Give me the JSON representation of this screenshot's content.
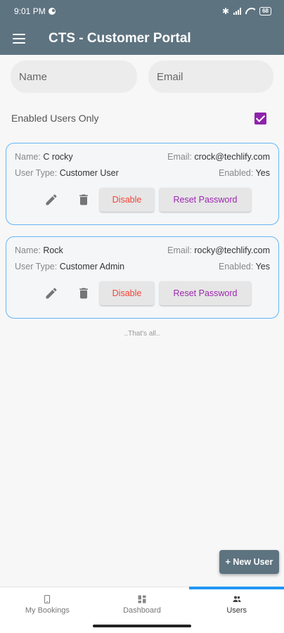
{
  "status_bar": {
    "time": "9:01 PM",
    "battery": "68"
  },
  "app_bar": {
    "title": "CTS - Customer Portal"
  },
  "search": {
    "name_placeholder": "Name",
    "email_placeholder": "Email"
  },
  "filter": {
    "enabled_only_label": "Enabled Users Only",
    "enabled_only_checked": true
  },
  "users": [
    {
      "name_label": "Name:",
      "name": "C rocky",
      "email_label": "Email:",
      "email": "crock@techlify.com",
      "type_label": "User Type:",
      "type": "Customer User",
      "enabled_label": "Enabled:",
      "enabled": "Yes",
      "disable_label": "Disable",
      "reset_label": "Reset Password"
    },
    {
      "name_label": "Name:",
      "name": "Rock",
      "email_label": "Email:",
      "email": "rocky@techlify.com",
      "type_label": "User Type:",
      "type": "Customer Admin",
      "enabled_label": "Enabled:",
      "enabled": "Yes",
      "disable_label": "Disable",
      "reset_label": "Reset Password"
    }
  ],
  "list_end_text": "..That's all..",
  "fab": {
    "label": "+ New User"
  },
  "bottom_nav": [
    {
      "label": "My Bookings",
      "icon": "phone-icon"
    },
    {
      "label": "Dashboard",
      "icon": "dashboard-icon"
    },
    {
      "label": "Users",
      "icon": "people-icon",
      "active": true
    }
  ],
  "colors": {
    "primary": "#5e7380",
    "accent_purple": "#9c27b0",
    "danger_red": "#f44336",
    "card_border": "#64b5f6",
    "active_tab": "#2196f3"
  }
}
